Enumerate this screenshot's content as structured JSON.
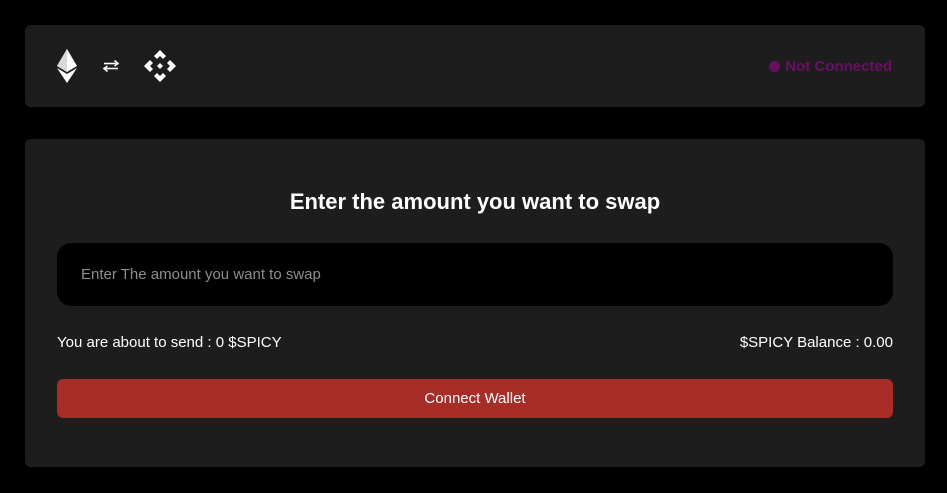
{
  "header": {
    "icons": {
      "source_chain": "ethereum-icon",
      "swap": "swap-arrows-icon",
      "target_chain": "binance-icon"
    },
    "status": {
      "label": "Not Connected",
      "color": "#6a0f63"
    }
  },
  "swap": {
    "title": "Enter the amount you want to swap",
    "amount_input": {
      "value": "",
      "placeholder": "Enter The amount you want to swap"
    },
    "send_summary": "You are about to send : 0 $SPICY",
    "balance": "$SPICY Balance : 0.00",
    "connect_button_label": "Connect Wallet",
    "connect_button_color": "#a82d27"
  }
}
